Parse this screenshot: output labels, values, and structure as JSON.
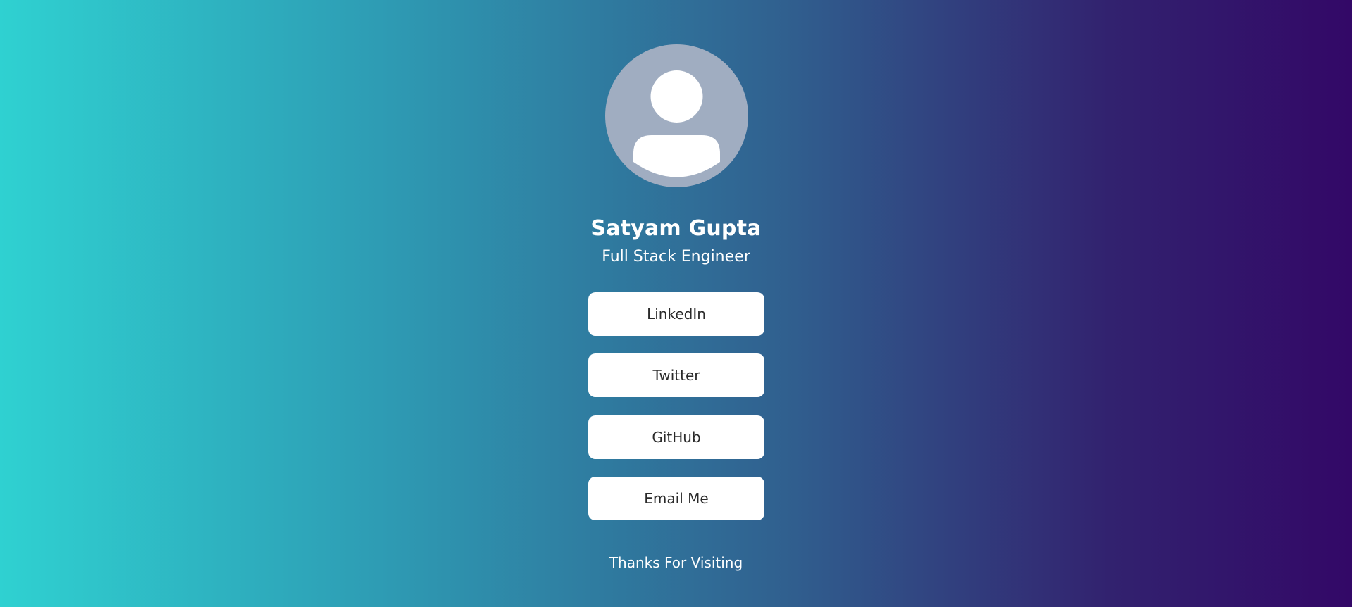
{
  "profile": {
    "avatar_icon": "user-icon",
    "name": "Satyam Gupta",
    "role": "Full Stack Engineer"
  },
  "links": [
    {
      "label": "LinkedIn"
    },
    {
      "label": "Twitter"
    },
    {
      "label": "GitHub"
    },
    {
      "label": "Email Me"
    }
  ],
  "footer": {
    "text": "Thanks For Visiting"
  },
  "colors": {
    "gradient_start": "#2fd1d1",
    "gradient_end": "#330867",
    "avatar_bg": "#a0adc1",
    "button_bg": "#ffffff",
    "button_text": "#2a2a2a"
  }
}
